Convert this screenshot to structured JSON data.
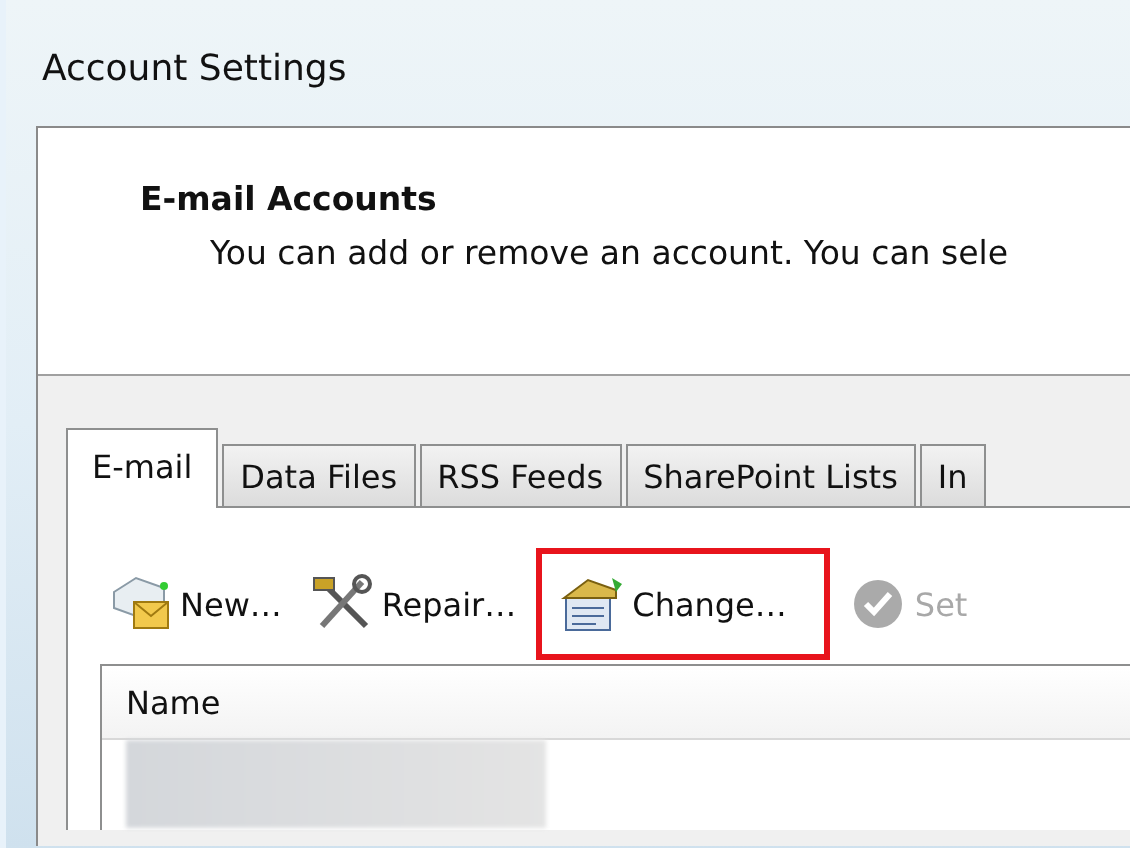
{
  "window": {
    "title": "Account Settings"
  },
  "header": {
    "title": "E-mail Accounts",
    "description": "You can add or remove an account. You can sele"
  },
  "tabs": [
    {
      "label": "E-mail",
      "selected": true
    },
    {
      "label": "Data Files",
      "selected": false
    },
    {
      "label": "RSS Feeds",
      "selected": false
    },
    {
      "label": "SharePoint Lists",
      "selected": false
    },
    {
      "label": "In",
      "selected": false
    }
  ],
  "toolbar": [
    {
      "kind": "new",
      "label": "New…",
      "disabled": false,
      "highlighted": false
    },
    {
      "kind": "repair",
      "label": "Repair…",
      "disabled": false,
      "highlighted": false
    },
    {
      "kind": "change",
      "label": "Change…",
      "disabled": false,
      "highlighted": true
    },
    {
      "kind": "set",
      "label": "Set",
      "disabled": true,
      "highlighted": false
    }
  ],
  "list": {
    "columns": [
      "Name"
    ]
  }
}
